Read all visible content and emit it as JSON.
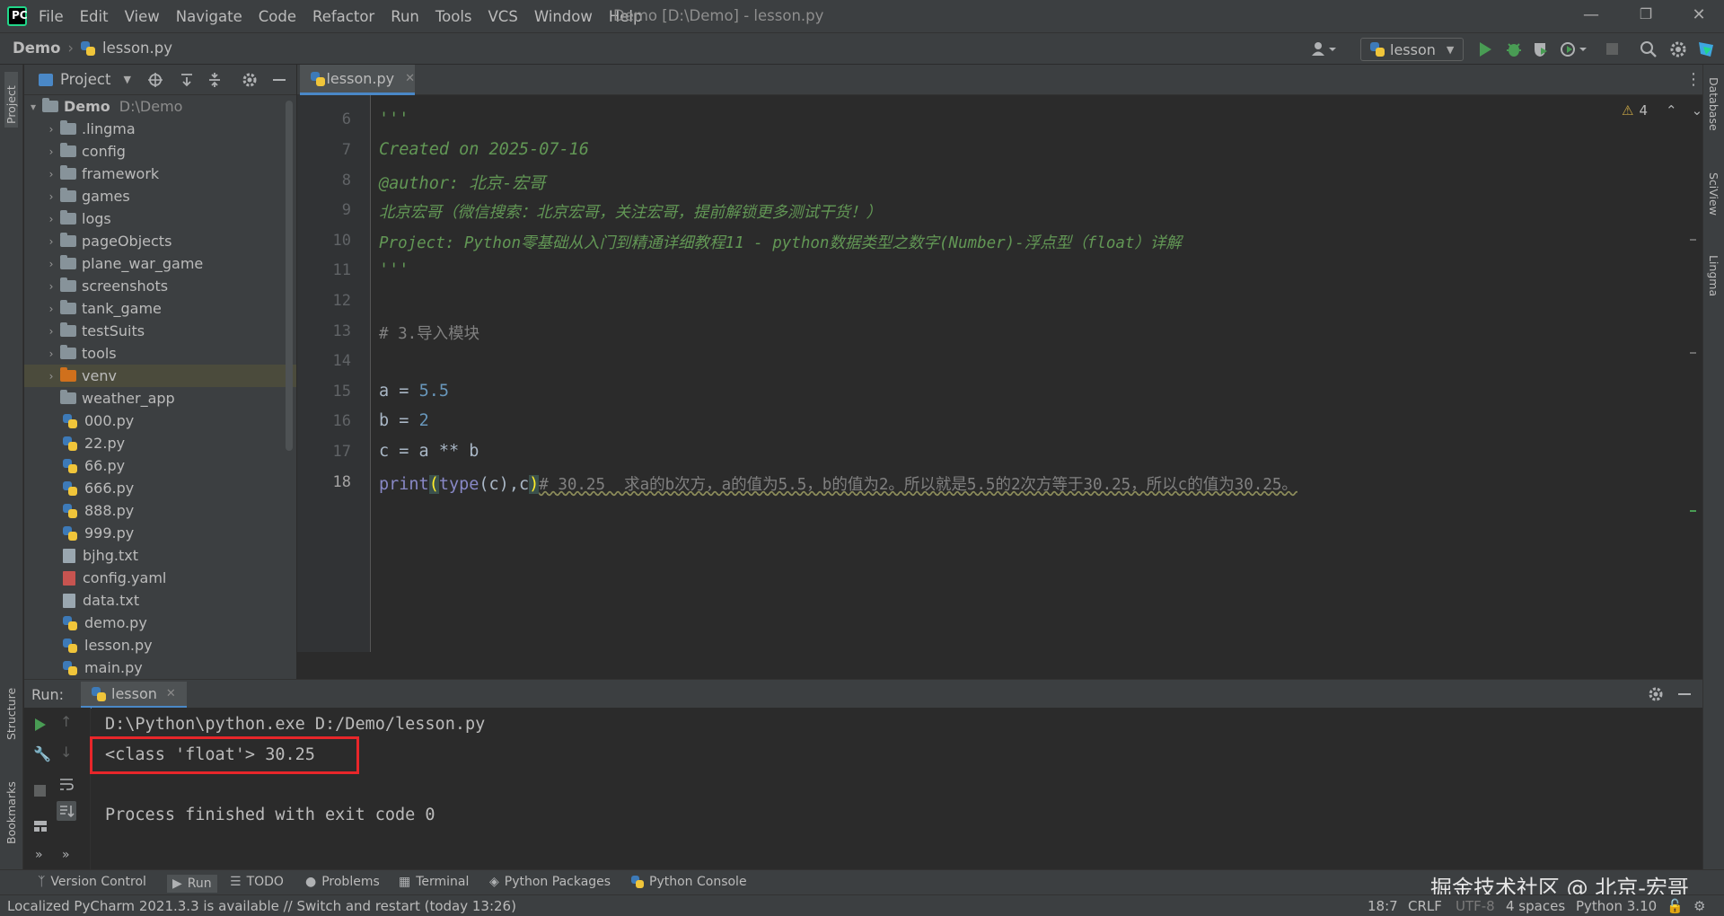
{
  "menu": {
    "items": [
      "File",
      "Edit",
      "View",
      "Navigate",
      "Code",
      "Refactor",
      "Run",
      "Tools",
      "VCS",
      "Window",
      "Help"
    ],
    "window_title": "Demo [D:\\Demo] - lesson.py",
    "app_icon_text": "PC"
  },
  "navbar": {
    "project": "Demo",
    "file": "lesson.py",
    "run_config": "lesson"
  },
  "sidebar": {
    "left_labels": [
      "Project",
      "Structure",
      "Bookmarks"
    ],
    "right_labels": [
      "Database",
      "SciView",
      "Lingma"
    ]
  },
  "project_panel": {
    "title": "Project",
    "root": {
      "name": "Demo",
      "path": "D:\\Demo"
    },
    "folders": [
      ".lingma",
      "config",
      "framework",
      "games",
      "logs",
      "pageObjects",
      "plane_war_game",
      "screenshots",
      "tank_game",
      "testSuits",
      "tools",
      "venv",
      "weather_app"
    ],
    "files": [
      "000.py",
      "22.py",
      "66.py",
      "666.py",
      "888.py",
      "999.py",
      "bjhg.txt",
      "config.yaml",
      "data.txt",
      "demo.py",
      "lesson.py",
      "main.py"
    ]
  },
  "editor": {
    "tab": "lesson.py",
    "warnings_count": "4",
    "line_numbers": [
      "6",
      "7",
      "8",
      "9",
      "10",
      "11",
      "12",
      "13",
      "14",
      "15",
      "16",
      "17",
      "18"
    ],
    "lines": {
      "l6": "'''",
      "l7": "Created on 2025-07-16",
      "l8": "@author: 北京-宏哥",
      "l9": "北京宏哥（微信搜索：北京宏哥，关注宏哥，提前解锁更多测试干货！）",
      "l10": "Project: Python零基础从入门到精通详细教程11 - python数据类型之数字(Number)-浮点型（float）详解",
      "l11": "'''",
      "l13": "# 3.导入模块",
      "l15_a": "a = ",
      "l15_b": "5.5",
      "l16_a": "b = ",
      "l16_b": "2",
      "l17": "c = a ** b",
      "l18_print": "print",
      "l18_open": "(",
      "l18_type": "type",
      "l18_args": "(c),c",
      "l18_close": ")",
      "l18_comment": "# 30.25  求a的b次方，a的值为5.5，b的值为2。所以就是5.5的2次方等于30.25，所以c的值为30.25。"
    }
  },
  "run_panel": {
    "label": "Run:",
    "tab": "lesson",
    "output": [
      "D:\\Python\\python.exe D:/Demo/lesson.py",
      "<class 'float'> 30.25",
      "",
      "Process finished with exit code 0"
    ]
  },
  "tool_windows": [
    "Version Control",
    "Run",
    "TODO",
    "Problems",
    "Terminal",
    "Python Packages",
    "Python Console"
  ],
  "watermark": "掘金技术社区 @ 北京-宏哥",
  "status_bar": {
    "message": "Localized PyCharm 2021.3.3 is available // Switch and restart (today 13:26)",
    "position": "18:7",
    "line_sep": "CRLF",
    "encoding": "UTF-8",
    "indent": "4 spaces",
    "interpreter": "Python 3.10"
  },
  "colors": {
    "accent": "#4a88c7",
    "highlight_box": "#e8262a",
    "run_green": "#499c54"
  }
}
